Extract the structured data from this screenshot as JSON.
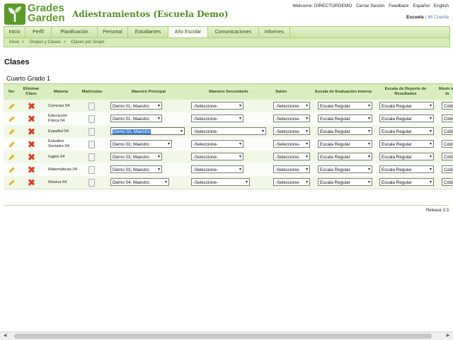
{
  "header": {
    "logo_line1": "Grades",
    "logo_line2": "Garden",
    "app_title": "Adiestramientos (Escuela Demo)",
    "welcome": "Welcome: DIRECTORDEMO",
    "logout": "Cerrar Sesión",
    "feedback": "Feedback",
    "lang_es": "Español",
    "lang_en": "English",
    "school": "Escuela",
    "my_account": "Mi Cuenta"
  },
  "nav": [
    {
      "label": "Inicio"
    },
    {
      "label": "Perfil"
    },
    {
      "label": "Planificación"
    },
    {
      "label": "Personal"
    },
    {
      "label": "Estudiantes"
    },
    {
      "label": "Año Escolar"
    },
    {
      "label": "Comunicaciones"
    },
    {
      "label": "Informes"
    }
  ],
  "breadcrumb": [
    "Inicio",
    "Grupos y Clases",
    "Clases por Grupo"
  ],
  "page_title": "Clases",
  "grade_title": "Cuarto Grado 1",
  "table": {
    "headers": {
      "ver": "Ver",
      "eliminar": "Eliminar Clase",
      "materia": "Materia",
      "matriculas": "Matrículas",
      "maestro_principal": "Maestro Principal",
      "maestro_secundario": "Maestro Secundario",
      "salon": "Salón",
      "escala_eval": "Escala de Evaluación Interna",
      "escala_reporte": "Escala de Reporte de Resultados",
      "mostrar": "Mostr en In"
    },
    "rows": [
      {
        "materia": "Ciencias 04",
        "principal": "Demo 01, Maestro",
        "secundario": "-Seleccione-",
        "salon": "-Seleccione-",
        "eval": "Escala Regular",
        "reporte": "Escala Regular",
        "codigo": "Códi"
      },
      {
        "materia": "Educación Física 04",
        "principal": "Demo 01, Maestro",
        "secundario": "-Seleccione-",
        "salon": "-Seleccione-",
        "eval": "Escala Regular",
        "reporte": "Escala Regular",
        "codigo": "Códi"
      },
      {
        "materia": "Español 04",
        "principal": "Demo 02, Maestro",
        "secundario": "-Seleccione-",
        "salon": "-Seleccione-",
        "eval": "Escala Regular",
        "reporte": "Escala Regular",
        "codigo": "Códi"
      },
      {
        "materia": "Estudios Sociales 04",
        "principal": "Demo 02, Maestro",
        "secundario": "-Seleccione-",
        "salon": "-Seleccione-",
        "eval": "Escala Regular",
        "reporte": "Escala Regular",
        "codigo": "Códi"
      },
      {
        "materia": "Inglés 04",
        "principal": "Demo 03, Maestro",
        "secundario": "-Seleccione-",
        "salon": "-Seleccione-",
        "eval": "Escala Regular",
        "reporte": "Escala Regular",
        "codigo": "Códi"
      },
      {
        "materia": "Matemáticas 04",
        "principal": "Demo 03, Maestro",
        "secundario": "-Seleccione-",
        "salon": "-Seleccione-",
        "eval": "Escala Regular",
        "reporte": "Escala Regular",
        "codigo": "Códi"
      },
      {
        "materia": "Música 04",
        "principal": "Demo 04, Maestro",
        "secundario": "-Seleccione-",
        "salon": "-Seleccione-",
        "eval": "Escala Regular",
        "reporte": "Escala Regular",
        "codigo": "Códi"
      }
    ]
  },
  "release": "Release 3.3",
  "icons": {
    "edit": "pencil-icon",
    "delete": "delete-x-icon",
    "enrollment": "document-icon",
    "logo": "sprout-icon"
  },
  "colors": {
    "brand_green": "#5a9a2a",
    "nav_bg": "#c9e3a3",
    "header_row": "#d9eec0",
    "delete_red": "#d83a1e",
    "pencil_yellow": "#e6b422",
    "selection_blue": "#3d7fd0"
  }
}
